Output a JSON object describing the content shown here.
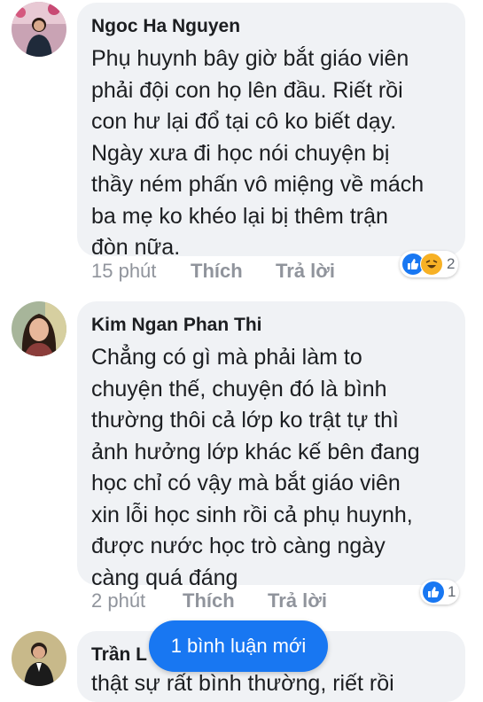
{
  "comments": [
    {
      "author": "Ngoc Ha Nguyen",
      "text": "Phụ huynh bây giờ bắt giáo viên\nphải đội con họ lên đầu. Riết rồi\ncon hư lại đổ tại cô ko biết dạy.\nNgày xưa đi học nói chuyện bị\nthầy ném phấn vô miệng về mách\nba mẹ ko khéo lại bị thêm trận\nđòn nữa.",
      "time": "15 phút",
      "like_label": "Thích",
      "reply_label": "Trả lời",
      "reaction_count": "2",
      "reactions": [
        "like-icon",
        "haha-icon"
      ]
    },
    {
      "author": "Kim Ngan Phan Thi",
      "text": "Chẳng có gì mà phải làm to\nchuyện thế, chuyện đó là bình\nthường thôi cả lớp ko trật tự thì\nảnh hưởng lớp khác kế bên đang\nhọc chỉ có vậy mà bắt giáo viên\nxin lỗi học sinh rồi cả phụ huynh,\nđược nước học trò càng ngày\ncàng quá đáng",
      "time": "2 phút",
      "like_label": "Thích",
      "reply_label": "Trả lời",
      "reaction_count": "1",
      "reactions": [
        "like-icon"
      ]
    },
    {
      "author": "Trần L",
      "text": "thật sự rất bình thường, riết rồi"
    }
  ],
  "new_comments_pill": "1 bình luận mới",
  "colors": {
    "accent": "#1877f2",
    "bubble": "#f0f2f5",
    "meta": "#90949c"
  }
}
